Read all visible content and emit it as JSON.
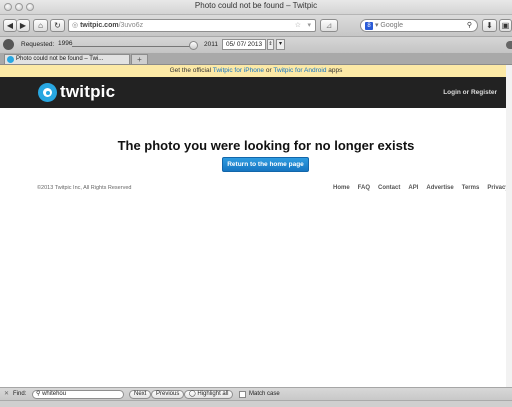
{
  "window": {
    "title": "Photo could not be found – Twitpic"
  },
  "nav": {
    "url_domain": "twitpic.com",
    "url_path": "/3uvo6z",
    "search_engine": "Google"
  },
  "wayback": {
    "requested_label": "Requested:",
    "start_year": "1996",
    "end_year": "2011",
    "date_value": "05/ 07/ 2013"
  },
  "tabs": [
    {
      "label": "Photo could not be found – Twi..."
    }
  ],
  "page": {
    "promo_prefix": "Get the official ",
    "promo_link1": "Twitpic for iPhone",
    "promo_mid": " or ",
    "promo_link2": "Twitpic for Android",
    "promo_suffix": " apps",
    "logo_text": "twitpic",
    "login_link": "Login or Register",
    "heading": "The photo you were looking for no longer exists",
    "home_button": "Return to the home page",
    "copyright": "©2013 Twitpic Inc, All Rights Reserved",
    "footer_links": [
      "Home",
      "FAQ",
      "Contact",
      "API",
      "Advertise",
      "Terms",
      "Privacy"
    ]
  },
  "findbar": {
    "find_label": "Find:",
    "find_value": "whitehou",
    "next": "Next",
    "previous": "Previous",
    "highlight": "Highlight all",
    "match_case": "Match case"
  },
  "colors": {
    "brand": "#28a7e1",
    "header_bg": "#222222",
    "promo_bg": "#fce9a6",
    "button": "#1f87d2"
  }
}
